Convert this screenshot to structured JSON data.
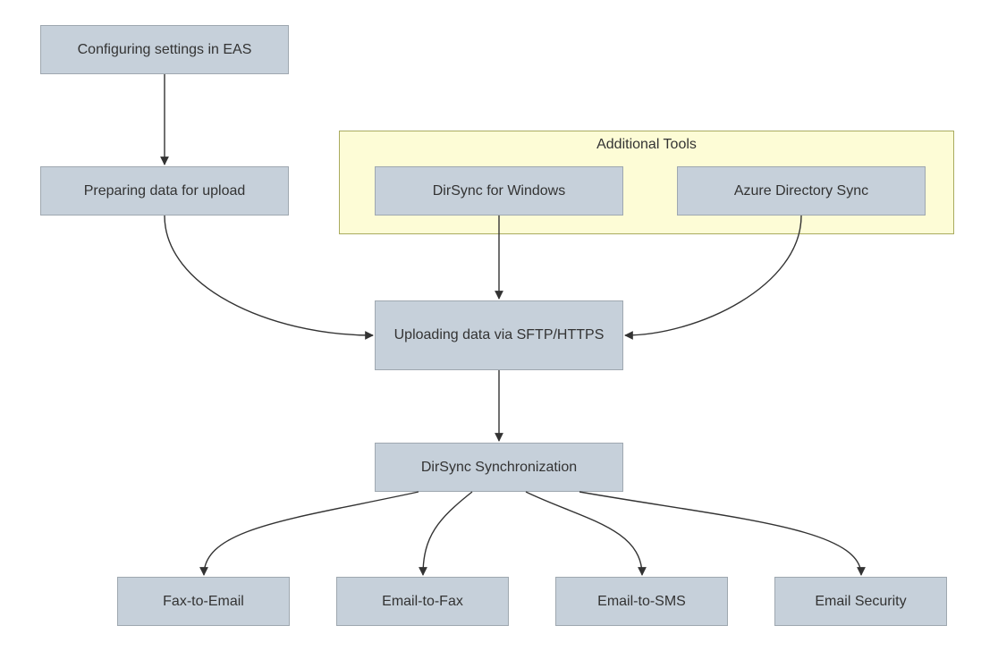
{
  "diagram": {
    "nodes": {
      "config": {
        "label": "Configuring settings in EAS"
      },
      "prepare": {
        "label": "Preparing data for upload"
      },
      "group": {
        "title": "Additional Tools"
      },
      "dirsyncw": {
        "label": "DirSync for Windows"
      },
      "azure": {
        "label": "Azure Directory Sync"
      },
      "upload": {
        "label": "Uploading data via SFTP/HTTPS"
      },
      "sync": {
        "label": "DirSync Synchronization"
      },
      "faxemail": {
        "label": "Fax-to-Email"
      },
      "emailfax": {
        "label": "Email-to-Fax"
      },
      "emailsms": {
        "label": "Email-to-SMS"
      },
      "emailsec": {
        "label": "Email Security"
      }
    },
    "edges": [
      {
        "from": "config",
        "to": "prepare"
      },
      {
        "from": "prepare",
        "to": "upload"
      },
      {
        "from": "dirsyncw",
        "to": "upload"
      },
      {
        "from": "azure",
        "to": "upload"
      },
      {
        "from": "upload",
        "to": "sync"
      },
      {
        "from": "sync",
        "to": "faxemail"
      },
      {
        "from": "sync",
        "to": "emailfax"
      },
      {
        "from": "sync",
        "to": "emailsms"
      },
      {
        "from": "sync",
        "to": "emailsec"
      }
    ]
  }
}
